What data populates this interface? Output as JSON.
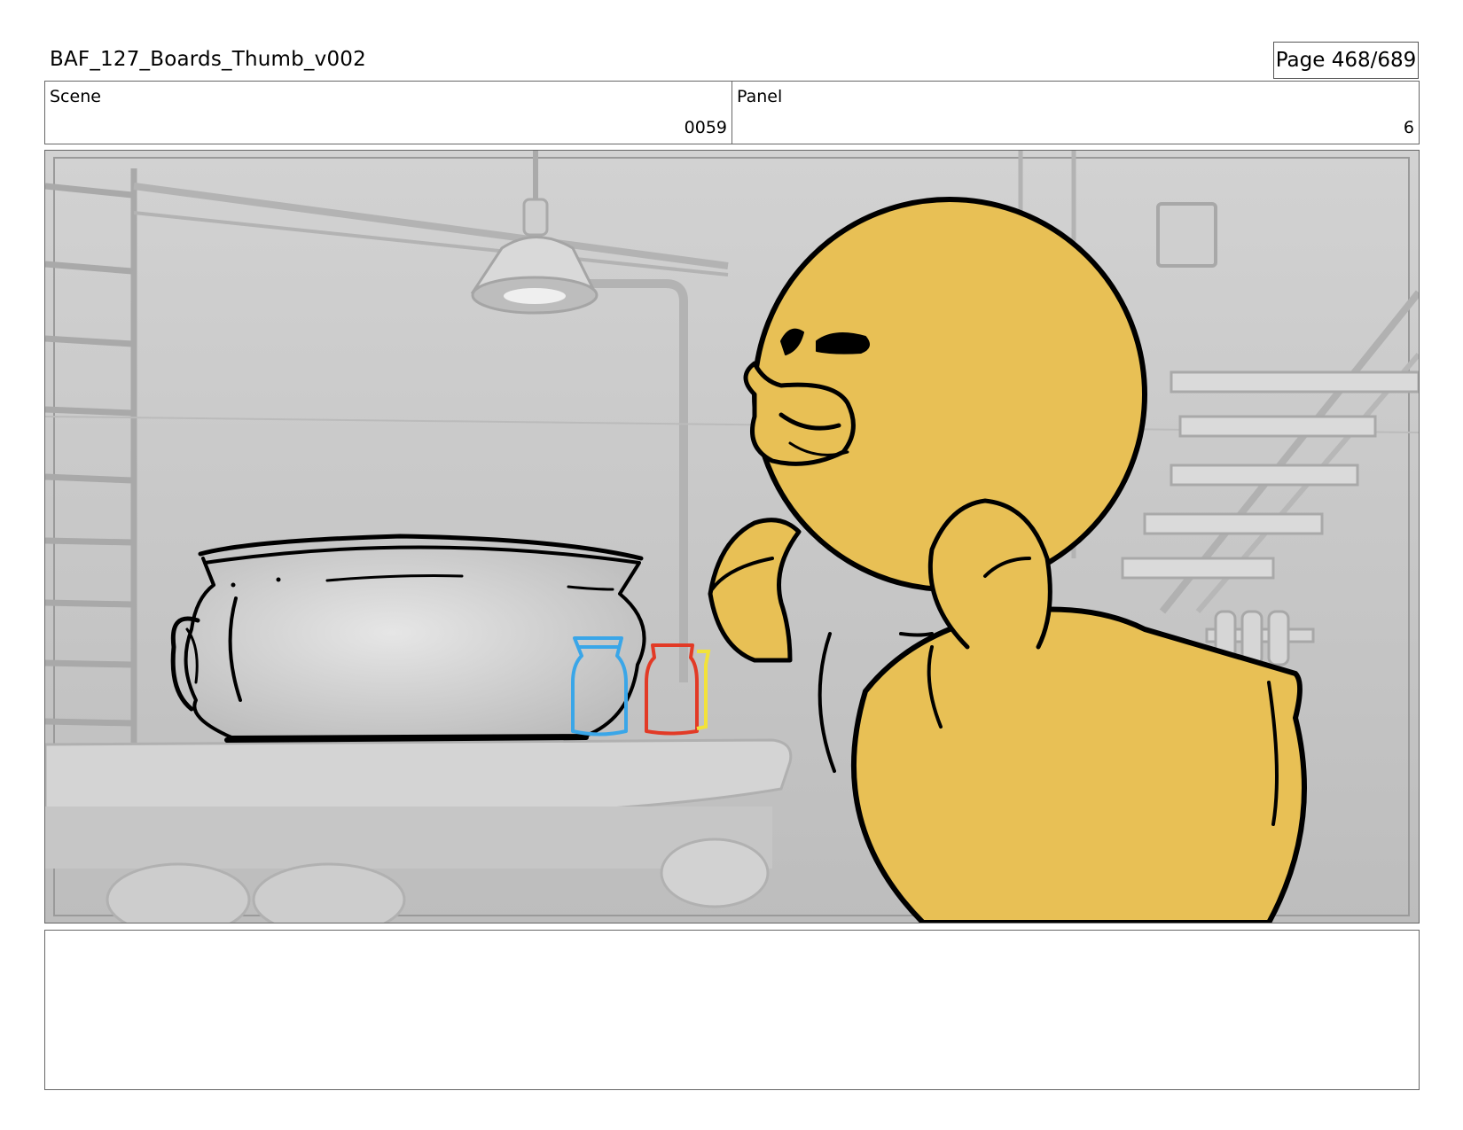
{
  "header": {
    "document_title": "BAF_127_Boards_Thumb_v002",
    "page_indicator": "Page 468/689"
  },
  "info": {
    "scene_label": "Scene",
    "scene_value": "0059",
    "panel_label": "Panel",
    "panel_value": "6"
  },
  "panel": {
    "content": "Storyboard drawing: yellow duck character beside a ceramic pot on a table with blue, red and yellow jars, grey 3D lab background",
    "colors": {
      "duck": "#E8C055",
      "jar_blue": "#3AA6E8",
      "jar_red": "#E23A26",
      "jar_yellow": "#F2E23A"
    }
  },
  "notes": {
    "text": ""
  }
}
